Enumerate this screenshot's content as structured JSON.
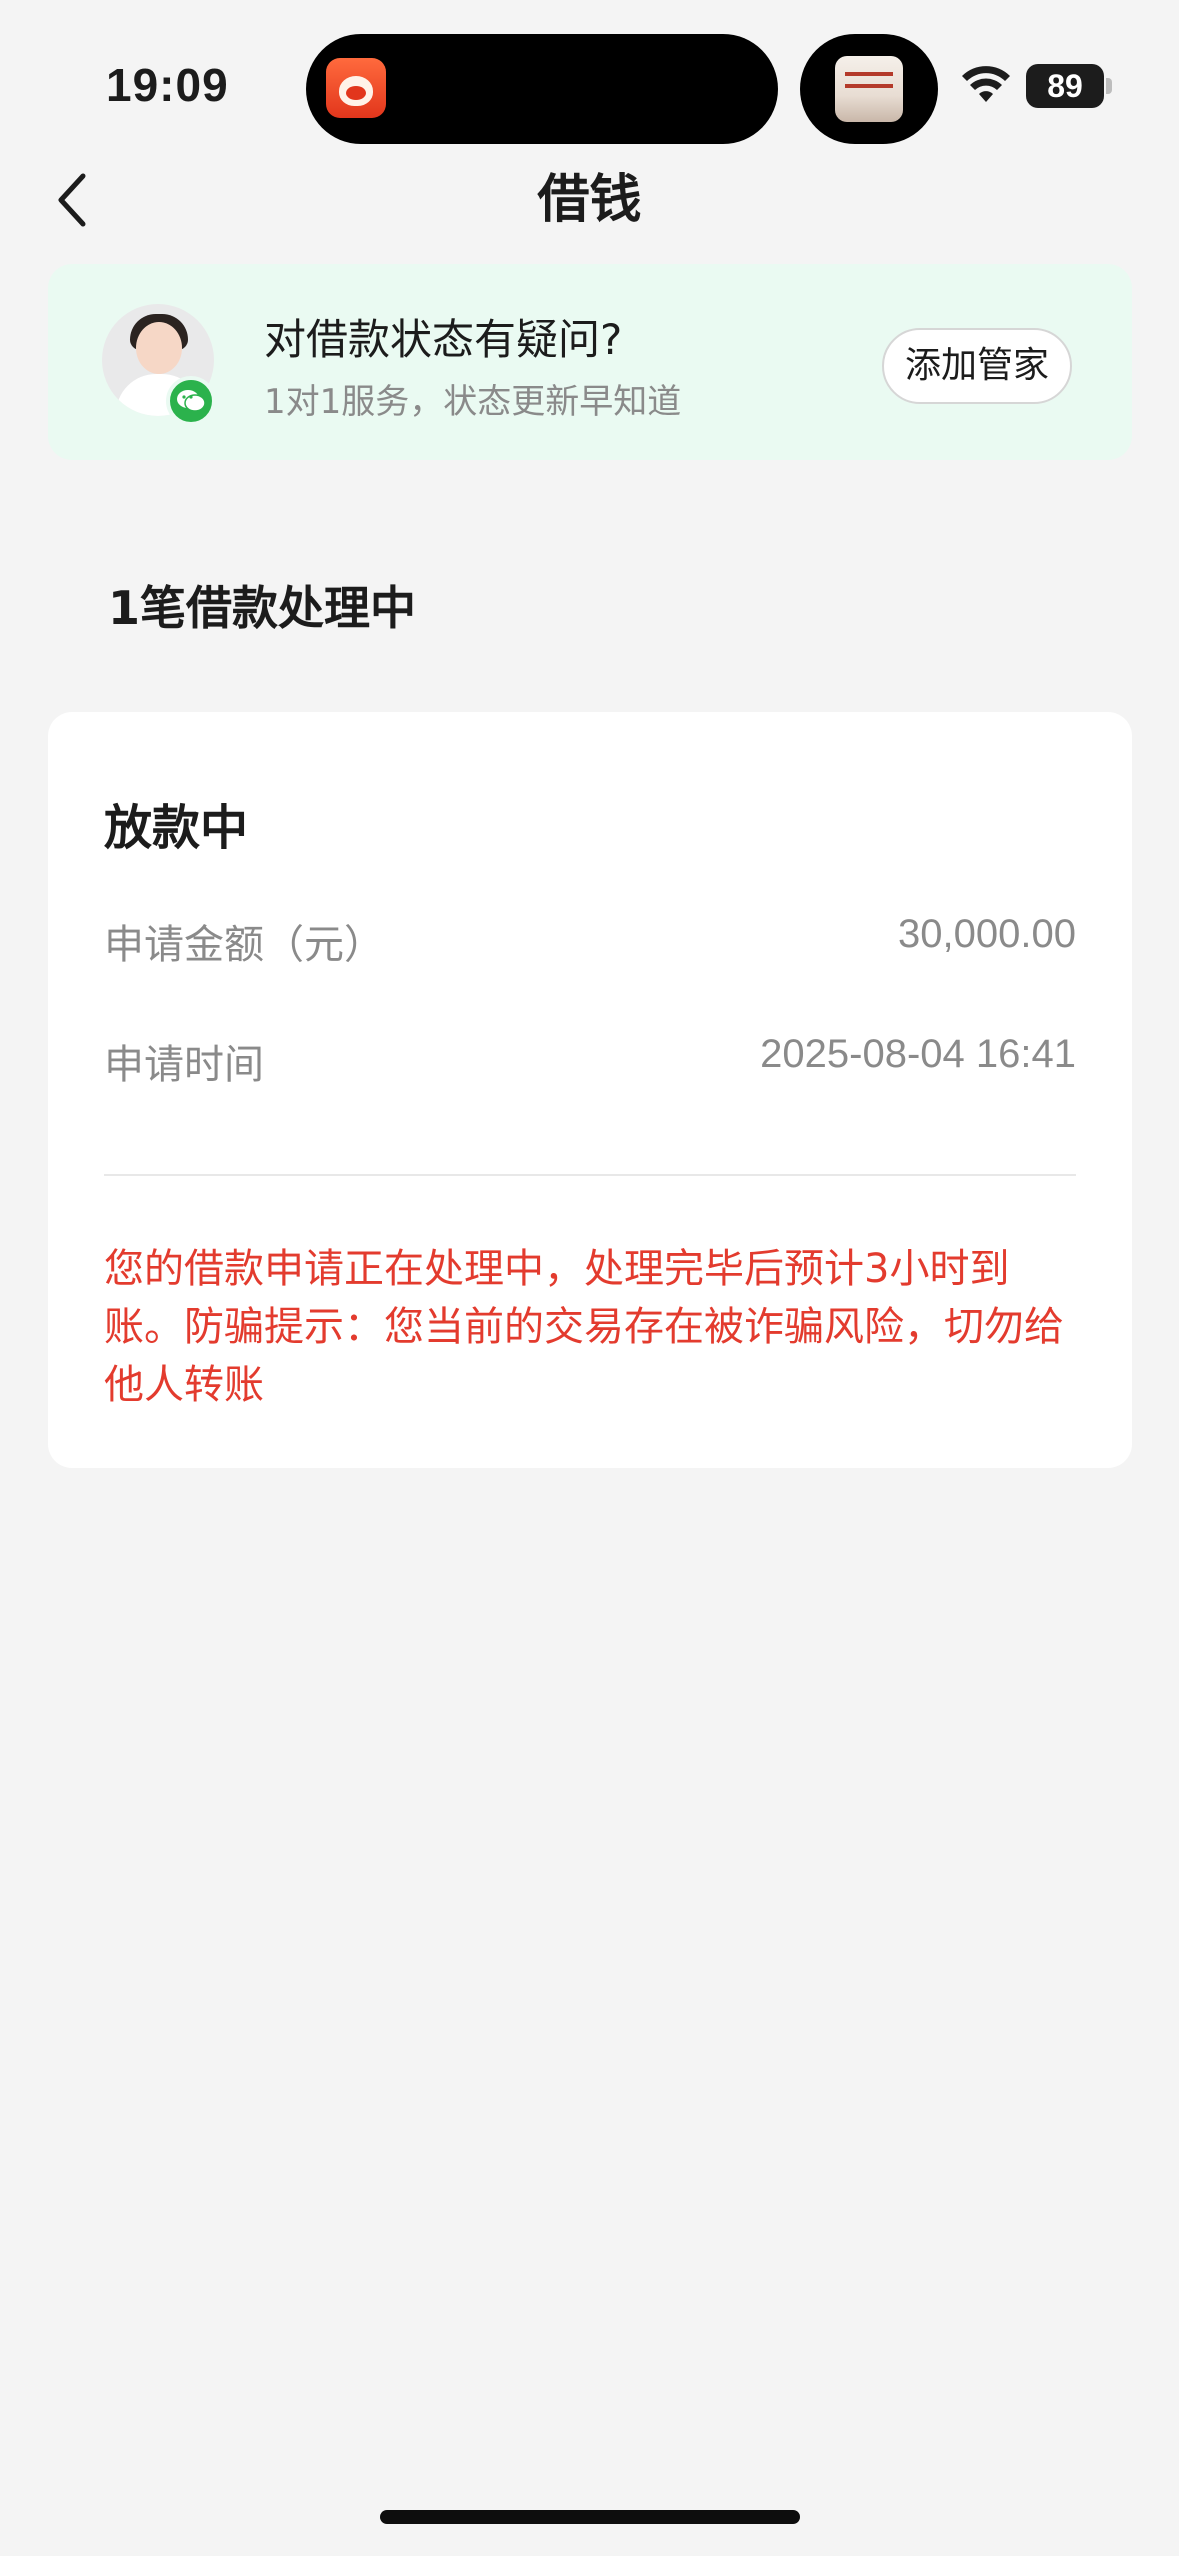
{
  "status_bar": {
    "time": "19:09",
    "battery": "89"
  },
  "nav": {
    "title": "借钱"
  },
  "promo": {
    "title": "对借款状态有疑问?",
    "subtitle": "1对1服务，状态更新早知道",
    "button_label": "添加管家"
  },
  "section": {
    "heading": "1笔借款处理中"
  },
  "loan_card": {
    "status": "放款中",
    "rows": [
      {
        "label": "申请金额（元）",
        "value": "30,000.00"
      },
      {
        "label": "申请时间",
        "value": "2025-08-04 16:41"
      }
    ],
    "notice": "您的借款申请正在处理中，处理完毕后预计3小时到账。防骗提示：您当前的交易存在被诈骗风险，切勿给他人转账"
  },
  "colors": {
    "background": "#f4f4f4",
    "promo_background": "#eafaf2",
    "notice_text": "#e33b2e",
    "wechat_green": "#2bb24c"
  },
  "icons": [
    "back-arrow-icon",
    "wifi-icon",
    "battery-icon",
    "wechat-icon",
    "app-icon"
  ]
}
